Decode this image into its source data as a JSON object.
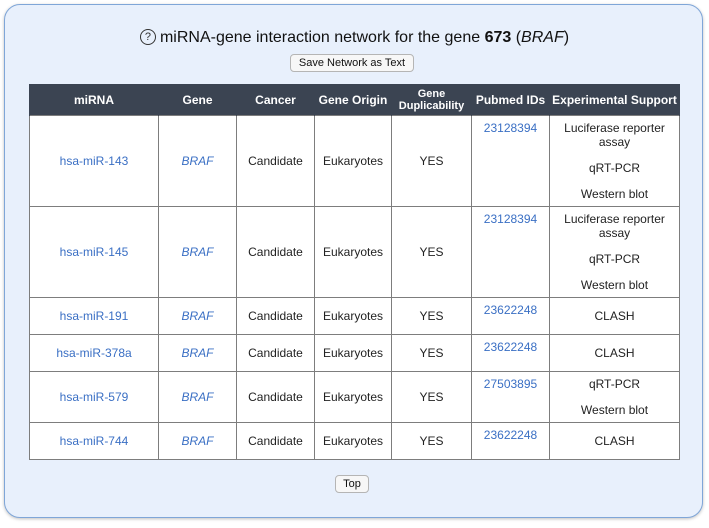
{
  "header": {
    "help_icon": "?",
    "title_prefix": "miRNA-gene interaction network for the gene ",
    "gene_id": "673",
    "title_paren_open": " (",
    "gene_symbol": "BRAF",
    "title_paren_close": ")"
  },
  "buttons": {
    "save_network": "Save Network as Text",
    "top": "Top"
  },
  "table": {
    "columns": [
      "miRNA",
      "Gene",
      "Cancer",
      "Gene Origin",
      "Gene Duplicability",
      "Pubmed IDs",
      "Experimental Support"
    ],
    "rows": [
      {
        "mirna": "hsa-miR-143",
        "gene": "BRAF",
        "cancer": "Candidate",
        "origin": "Eukaryotes",
        "dup": "YES",
        "pubmed": "23128394",
        "support": [
          "Luciferase reporter assay",
          "qRT-PCR",
          "Western blot"
        ]
      },
      {
        "mirna": "hsa-miR-145",
        "gene": "BRAF",
        "cancer": "Candidate",
        "origin": "Eukaryotes",
        "dup": "YES",
        "pubmed": "23128394",
        "support": [
          "Luciferase reporter assay",
          "qRT-PCR",
          "Western blot"
        ]
      },
      {
        "mirna": "hsa-miR-191",
        "gene": "BRAF",
        "cancer": "Candidate",
        "origin": "Eukaryotes",
        "dup": "YES",
        "pubmed": "23622248",
        "support": [
          "CLASH"
        ]
      },
      {
        "mirna": "hsa-miR-378a",
        "gene": "BRAF",
        "cancer": "Candidate",
        "origin": "Eukaryotes",
        "dup": "YES",
        "pubmed": "23622248",
        "support": [
          "CLASH"
        ]
      },
      {
        "mirna": "hsa-miR-579",
        "gene": "BRAF",
        "cancer": "Candidate",
        "origin": "Eukaryotes",
        "dup": "YES",
        "pubmed": "27503895",
        "support": [
          "qRT-PCR",
          "Western blot"
        ]
      },
      {
        "mirna": "hsa-miR-744",
        "gene": "BRAF",
        "cancer": "Candidate",
        "origin": "Eukaryotes",
        "dup": "YES",
        "pubmed": "23622248",
        "support": [
          "CLASH"
        ]
      }
    ]
  },
  "colors": {
    "panel_bg": "#e8f0fc",
    "header_bg": "#3b4452",
    "link": "#3a6fc4"
  }
}
